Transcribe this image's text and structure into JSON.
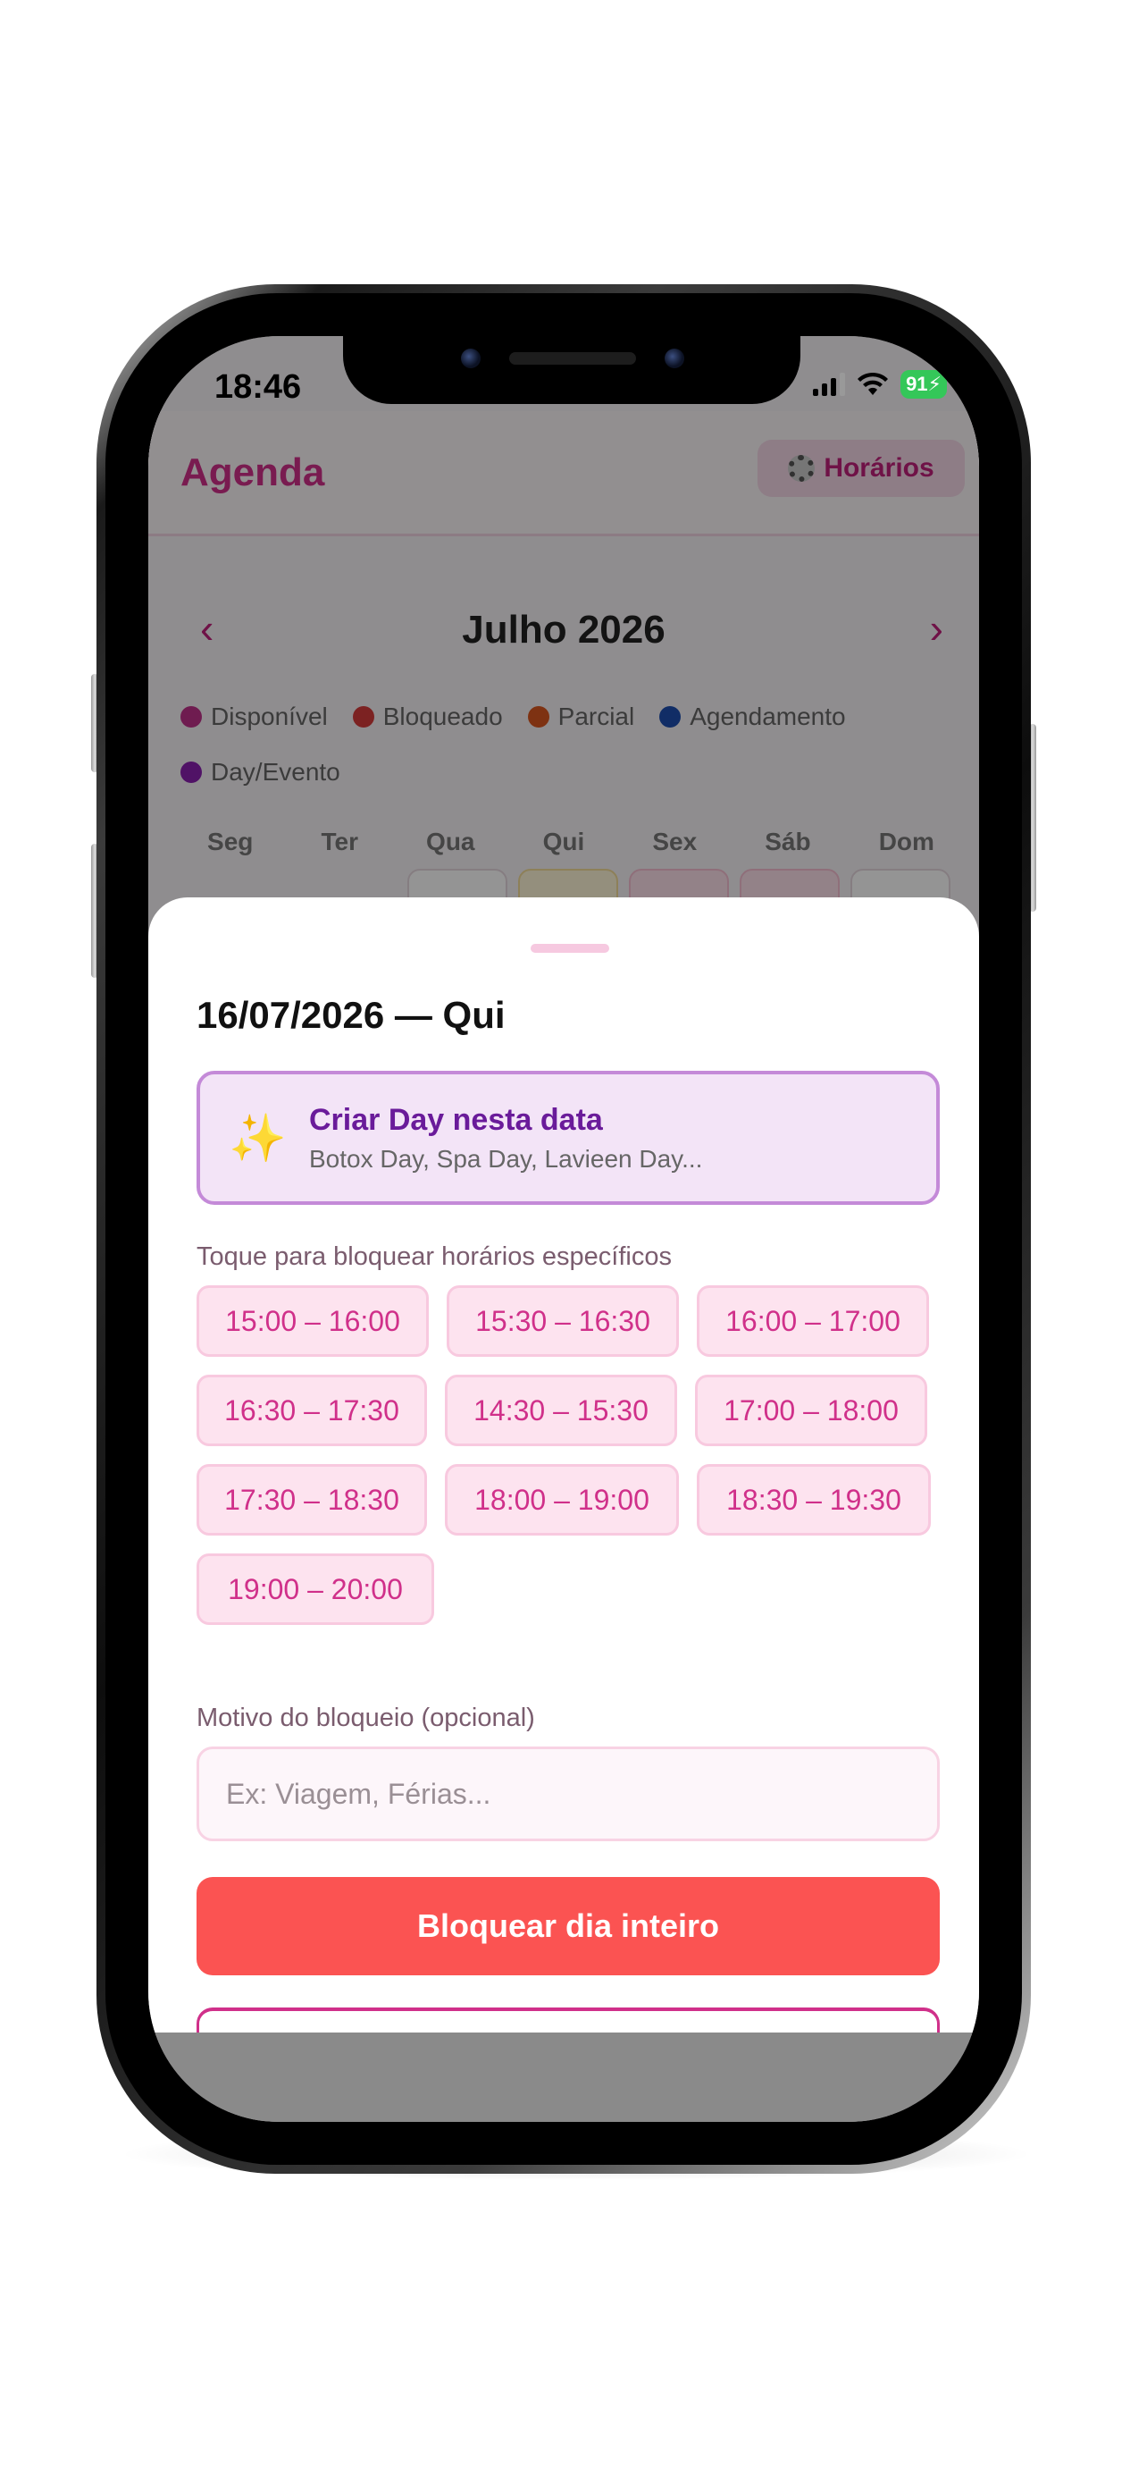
{
  "status_bar": {
    "time": "18:46",
    "battery": "91"
  },
  "header": {
    "title": "Agenda",
    "hours_button": "Horários"
  },
  "calendar": {
    "prev_arrow": "‹",
    "next_arrow": "›",
    "month_title": "Julho 2026",
    "legend": [
      {
        "label": "Disponível",
        "color": "#c0318a"
      },
      {
        "label": "Bloqueado",
        "color": "#d63b3b"
      },
      {
        "label": "Parcial",
        "color": "#d9571f"
      },
      {
        "label": "Agendamento",
        "color": "#1e4fb0"
      },
      {
        "label": "Day/Evento",
        "color": "#8a1fb0"
      }
    ],
    "weekdays": [
      "Seg",
      "Ter",
      "Qua",
      "Qui",
      "Sex",
      "Sáb",
      "Dom"
    ]
  },
  "sheet": {
    "title": "16/07/2026 — Qui",
    "create_day": {
      "icon": "sparkles-icon",
      "title": "Criar Day nesta data",
      "subtitle": "Botox Day, Spa Day, Lavieen Day..."
    },
    "slots_label": "Toque para bloquear horários específicos",
    "slots": [
      "15:00 – 16:00",
      "15:30 – 16:30",
      "16:00 – 17:00",
      "16:30 – 17:30",
      "14:30 – 15:30",
      "17:00 – 18:00",
      "17:30 – 18:30",
      "18:00 – 19:00",
      "18:30 – 19:30",
      "19:00 – 20:00"
    ],
    "reason_label": "Motivo do bloqueio (opcional)",
    "reason_placeholder": "Ex: Viagem, Férias...",
    "reason_value": "",
    "block_button": "Bloquear dia inteiro"
  },
  "colors": {
    "brand": "#d0308a",
    "danger": "#fb5352",
    "day_event": "#6a1b9a"
  }
}
